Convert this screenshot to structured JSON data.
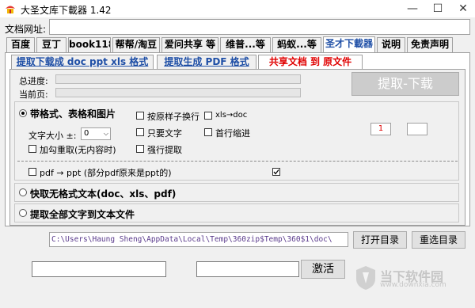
{
  "window": {
    "title": "大圣文库下載器 1.42",
    "minimize": "—",
    "maximize": "☐",
    "close": "✕"
  },
  "url_bar": {
    "label": "文档网址:",
    "value": ""
  },
  "main_tabs": [
    {
      "label": "百度"
    },
    {
      "label": "豆丁"
    },
    {
      "label": "book118"
    },
    {
      "label": "帮帮/淘豆"
    },
    {
      "label": "爱问共享 等"
    },
    {
      "label": "维普...等"
    },
    {
      "label": "蚂蚁...等"
    },
    {
      "label": "圣才下載器",
      "active": true
    },
    {
      "label": "说明"
    },
    {
      "label": "免责声明"
    }
  ],
  "sub_tabs": [
    {
      "label": "提取下载成 doc ppt xls 格式"
    },
    {
      "label": "提取生成 PDF 格式"
    },
    {
      "label": "共享文档 到 原文件",
      "active": true
    }
  ],
  "progress": {
    "total_label": "总进度:",
    "current_label": "当前页:",
    "total_value": 0,
    "current_value": 0
  },
  "extract_button": "提取-下载",
  "options": {
    "format_radio": "带格式、表格和图片",
    "font_size_label": "文字大小 ±:",
    "font_size_value": "0",
    "bold_redraw": "加勾重取(无内容时)",
    "keep_line_break": "按原样子换行",
    "text_only": "只要文字",
    "force_extract": "强行提取",
    "xls_to_doc": "xls→doc",
    "first_indent": "首行缩进",
    "num1": "1",
    "num2": "",
    "pdf_to_ppt": "pdf → ppt (部分pdf原来是ppt的)",
    "pdf_to_ppt_checked": true,
    "plain_radio": "快取无格式文本(doc、xls、pdf)",
    "all_text_radio": "提取全部文字到文本文件"
  },
  "path": {
    "value": "C:\\Users\\Haung Sheng\\AppData\\Local\\Temp\\360zip$Temp\\360$1\\doc\\"
  },
  "buttons": {
    "open_dir": "打开目录",
    "choose_dir": "重选目录",
    "activate": "激活"
  },
  "watermark": {
    "text": "当下软件园",
    "sub": "www.downxia.com"
  },
  "colors": {
    "active_tab_text": "#1f4fa6",
    "shared_tab_text": "#e00000",
    "path_text": "#5a3a8c"
  }
}
